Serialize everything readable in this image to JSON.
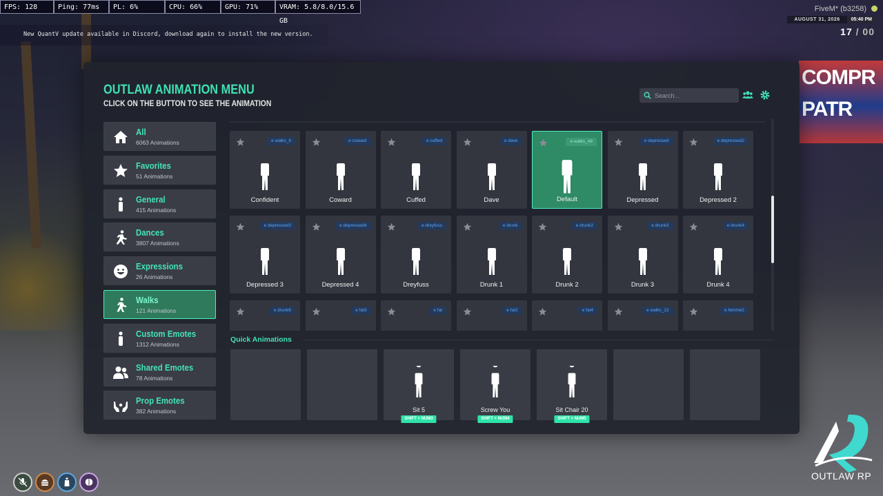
{
  "hud": {
    "fps": "FPS: 128",
    "ping": "Ping: 77ms",
    "pl": "PL: 6%",
    "cpu": "CPU: 66%",
    "gpu": "GPU: 71%",
    "vram": "VRAM: 5.8/8.0/15.6 GB",
    "notice": "New QuantV update available in Discord, download again to install the new version.",
    "fivem": "FiveM* (b3258)",
    "date": "AUGUST 31, 2026",
    "time": "05:40 PM",
    "players": "17",
    "players_sep": " / ",
    "players_max": "00"
  },
  "menu": {
    "title": "OUTLAW ANIMATION MENU",
    "subtitle": "CLICK ON THE BUTTON TO SEE THE ANIMATION",
    "search_placeholder": "Search...",
    "categories": [
      {
        "name": "All",
        "count": "6063 Animations",
        "icon": "home-icon"
      },
      {
        "name": "Favorites",
        "count": "51 Animations",
        "icon": "star-icon"
      },
      {
        "name": "General",
        "count": "415 Animations",
        "icon": "person-icon"
      },
      {
        "name": "Dances",
        "count": "3807 Animations",
        "icon": "dance-icon"
      },
      {
        "name": "Expressions",
        "count": "26 Animations",
        "icon": "smile-icon"
      },
      {
        "name": "Walks",
        "count": "121 Animations",
        "icon": "walk-icon"
      },
      {
        "name": "Custom Emotes",
        "count": "1312 Animations",
        "icon": "person-icon"
      },
      {
        "name": "Shared Emotes",
        "count": "78 Animations",
        "icon": "users-icon"
      },
      {
        "name": "Prop Emotes",
        "count": "382 Animations",
        "icon": "hands-icon"
      }
    ],
    "active_category": "Walks",
    "cards": [
      {
        "label": "Confident",
        "cmd": "e walks_8"
      },
      {
        "label": "Coward",
        "cmd": "e coward"
      },
      {
        "label": "Cuffed",
        "cmd": "e cuffed"
      },
      {
        "label": "Dave",
        "cmd": "e dave"
      },
      {
        "label": "Default",
        "cmd": "e walks_49"
      },
      {
        "label": "Depressed",
        "cmd": "e depressed"
      },
      {
        "label": "Depressed 2",
        "cmd": "e depressed2"
      },
      {
        "label": "Depressed 3",
        "cmd": "e depressed3"
      },
      {
        "label": "Depressed 4",
        "cmd": "e depressed4"
      },
      {
        "label": "Dreyfuss",
        "cmd": "e dreyfuss"
      },
      {
        "label": "Drunk 1",
        "cmd": "e drunk"
      },
      {
        "label": "Drunk 2",
        "cmd": "e drunk2"
      },
      {
        "label": "Drunk 3",
        "cmd": "e drunk3"
      },
      {
        "label": "Drunk 4",
        "cmd": "e drunk4"
      },
      {
        "label": "",
        "cmd": "e drunk6"
      },
      {
        "label": "",
        "cmd": "e fat3"
      },
      {
        "label": "",
        "cmd": "e fat"
      },
      {
        "label": "",
        "cmd": "e fat2"
      },
      {
        "label": "",
        "cmd": "e fat4"
      },
      {
        "label": "",
        "cmd": "e walks_12"
      },
      {
        "label": "",
        "cmd": "e femme2"
      }
    ],
    "selected_card": "Default",
    "quick_title": "Quick Animations",
    "quick": [
      {
        "label": "",
        "key": ""
      },
      {
        "label": "",
        "key": ""
      },
      {
        "label": "Sit 5",
        "key": "SHIFT + NUM3"
      },
      {
        "label": "Screw You",
        "key": "SHIFT + NUM4"
      },
      {
        "label": "Sit Chair 20",
        "key": "SHIFT + NUM5"
      },
      {
        "label": "",
        "key": ""
      },
      {
        "label": "",
        "key": ""
      }
    ]
  },
  "logo": {
    "text": "OUTLAW RP"
  },
  "colors": {
    "accent": "#43e3b6",
    "active_bg": "#2f7a5c",
    "cmd_blue": "#57a7ff",
    "panel": "#20232c"
  }
}
